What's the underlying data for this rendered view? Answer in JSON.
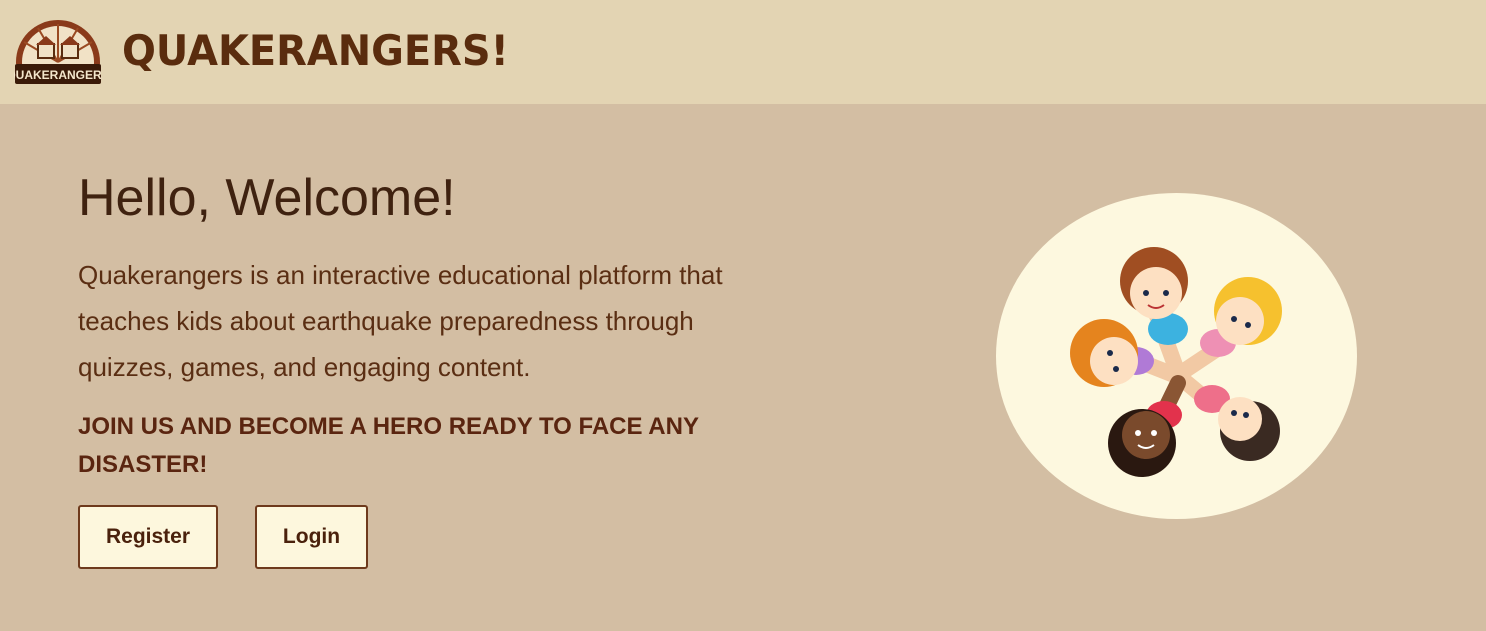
{
  "header": {
    "brand": "QUAKERANGERS!",
    "logo_text": "QUAKERANGERS"
  },
  "hero": {
    "title": "Hello, Welcome!",
    "description": "Quakerangers is an interactive educational platform that teaches kids about earthquake preparedness through quizzes, games, and engaging content.",
    "cta": "JOIN US AND BECOME A HERO READY TO FACE ANY DISASTER!"
  },
  "buttons": {
    "register": "Register",
    "login": "Login"
  },
  "colors": {
    "page_bg": "#d3bea3",
    "header_bg": "#e3d4b3",
    "brand": "#5a2c0e",
    "button_bg": "#fdf7dd",
    "circle_bg": "#fdf8df"
  }
}
